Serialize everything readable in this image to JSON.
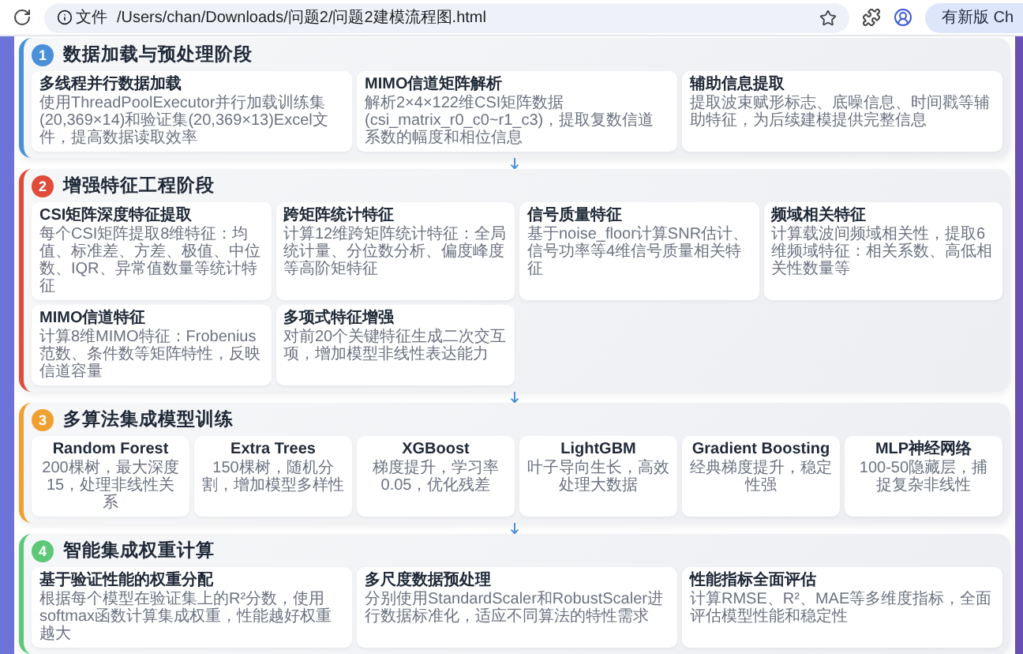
{
  "browser": {
    "chip": "文件",
    "url": "/Users/chan/Downloads/问题2/问题2建模流程图.html",
    "update_button": "有新版 Ch"
  },
  "stages": [
    {
      "number": "1",
      "title": "数据加载与预处理阶段",
      "color": "#4a90d9",
      "kind": "feature",
      "cards": [
        {
          "title": "多线程并行数据加载",
          "text": "使用ThreadPoolExecutor并行加载训练集(20,369×14)和验证集(20,369×13)Excel文件，提高数据读取效率"
        },
        {
          "title": "MIMO信道矩阵解析",
          "text": "解析2×4×122维CSI矩阵数据(csi_matrix_r0_c0~r1_c3)，提取复数信道系数的幅度和相位信息"
        },
        {
          "title": "辅助信息提取",
          "text": "提取波束赋形标志、底噪信息、时间戳等辅助特征，为后续建模提供完整信息"
        }
      ]
    },
    {
      "number": "2",
      "title": "增强特征工程阶段",
      "color": "#e04b3a",
      "kind": "feature",
      "cards": [
        {
          "title": "CSI矩阵深度特征提取",
          "text": "每个CSI矩阵提取8维特征：均值、标准差、方差、极值、中位数、IQR、异常值数量等统计特征"
        },
        {
          "title": "跨矩阵统计特征",
          "text": "计算12维跨矩阵统计特征：全局统计量、分位数分析、偏度峰度等高阶矩特征"
        },
        {
          "title": "信号质量特征",
          "text": "基于noise_floor计算SNR估计、信号功率等4维信号质量相关特征"
        },
        {
          "title": "频域相关特征",
          "text": "计算载波间频域相关性，提取6维频域特征：相关系数、高低相关性数量等"
        },
        {
          "title": "MIMO信道特征",
          "text": "计算8维MIMO特征：Frobenius范数、条件数等矩阵特性，反映信道容量"
        },
        {
          "title": "多项式特征增强",
          "text": "对前20个关键特征生成二次交互项，增加模型非线性表达能力"
        }
      ]
    },
    {
      "number": "3",
      "title": "多算法集成模型训练",
      "color": "#f0a030",
      "kind": "model",
      "cards": [
        {
          "title": "Random Forest",
          "text": "200棵树，最大深度15，处理非线性关系"
        },
        {
          "title": "Extra Trees",
          "text": "150棵树，随机分割，增加模型多样性"
        },
        {
          "title": "XGBoost",
          "text": "梯度提升，学习率0.05，优化残差"
        },
        {
          "title": "LightGBM",
          "text": "叶子导向生长，高效处理大数据"
        },
        {
          "title": "Gradient Boosting",
          "text": "经典梯度提升，稳定性强"
        },
        {
          "title": "MLP神经网络",
          "text": "100-50隐藏层，捕捉复杂非线性"
        }
      ]
    },
    {
      "number": "4",
      "title": "智能集成权重计算",
      "color": "#5cc878",
      "kind": "feature",
      "cards": [
        {
          "title": "基于验证性能的权重分配",
          "text": "根据每个模型在验证集上的R²分数，使用softmax函数计算集成权重，性能越好权重越大"
        },
        {
          "title": "多尺度数据预处理",
          "text": "分别使用StandardScaler和RobustScaler进行数据标准化，适应不同算法的特性需求"
        },
        {
          "title": "性能指标全面评估",
          "text": "计算RMSE、R²、MAE等多维度指标，全面评估模型性能和稳定性"
        }
      ]
    }
  ]
}
